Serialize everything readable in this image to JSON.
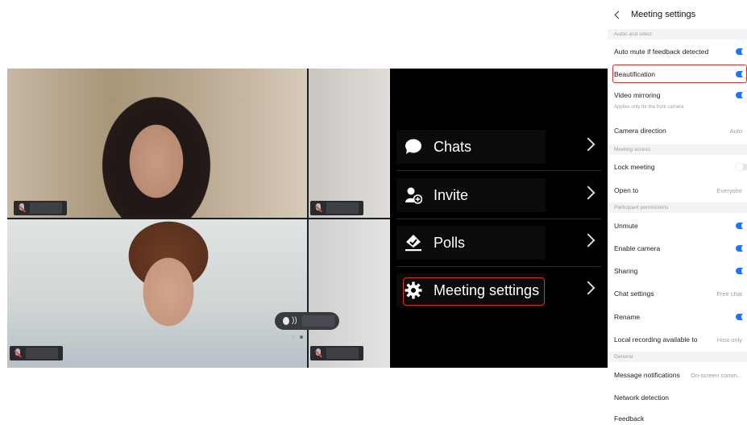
{
  "menu": {
    "items": [
      {
        "label": "Chats",
        "icon": "chat-bubble-icon"
      },
      {
        "label": "Invite",
        "icon": "add-user-icon"
      },
      {
        "label": "Polls",
        "icon": "poll-icon"
      },
      {
        "label": "Meeting settings",
        "icon": "gear-icon"
      }
    ]
  },
  "settings": {
    "title": "Meeting settings",
    "sections": {
      "audio_video": "Audio and video",
      "meeting_access": "Meeting access",
      "participant_permissions": "Participant permissions",
      "general": "General"
    },
    "rows": {
      "auto_mute": {
        "label": "Auto mute if feedback detected",
        "on": true
      },
      "beautification": {
        "label": "Beautification",
        "on": true
      },
      "video_mirroring": {
        "label": "Video mirroring",
        "sub": "Applies only for the front camera",
        "on": true
      },
      "camera_direction": {
        "label": "Camera direction",
        "value": "Auto"
      },
      "lock_meeting": {
        "label": "Lock meeting",
        "on": false
      },
      "open_to": {
        "label": "Open to",
        "value": "Everyone"
      },
      "unmute": {
        "label": "Unmute",
        "on": true
      },
      "enable_camera": {
        "label": "Enable camera",
        "on": true
      },
      "sharing": {
        "label": "Sharing",
        "on": true
      },
      "chat_settings": {
        "label": "Chat settings",
        "value": "Free chat"
      },
      "rename": {
        "label": "Rename",
        "on": true
      },
      "local_recording": {
        "label": "Local recording available to",
        "value": "Host only"
      },
      "message_notifications": {
        "label": "Message notifications",
        "value": "On-screen comm..."
      },
      "network_detection": {
        "label": "Network detection"
      },
      "feedback": {
        "label": "Feedback"
      }
    }
  },
  "colors": {
    "accent": "#1677ff",
    "highlight": "#d9302c",
    "panel_dark": "#000000"
  }
}
